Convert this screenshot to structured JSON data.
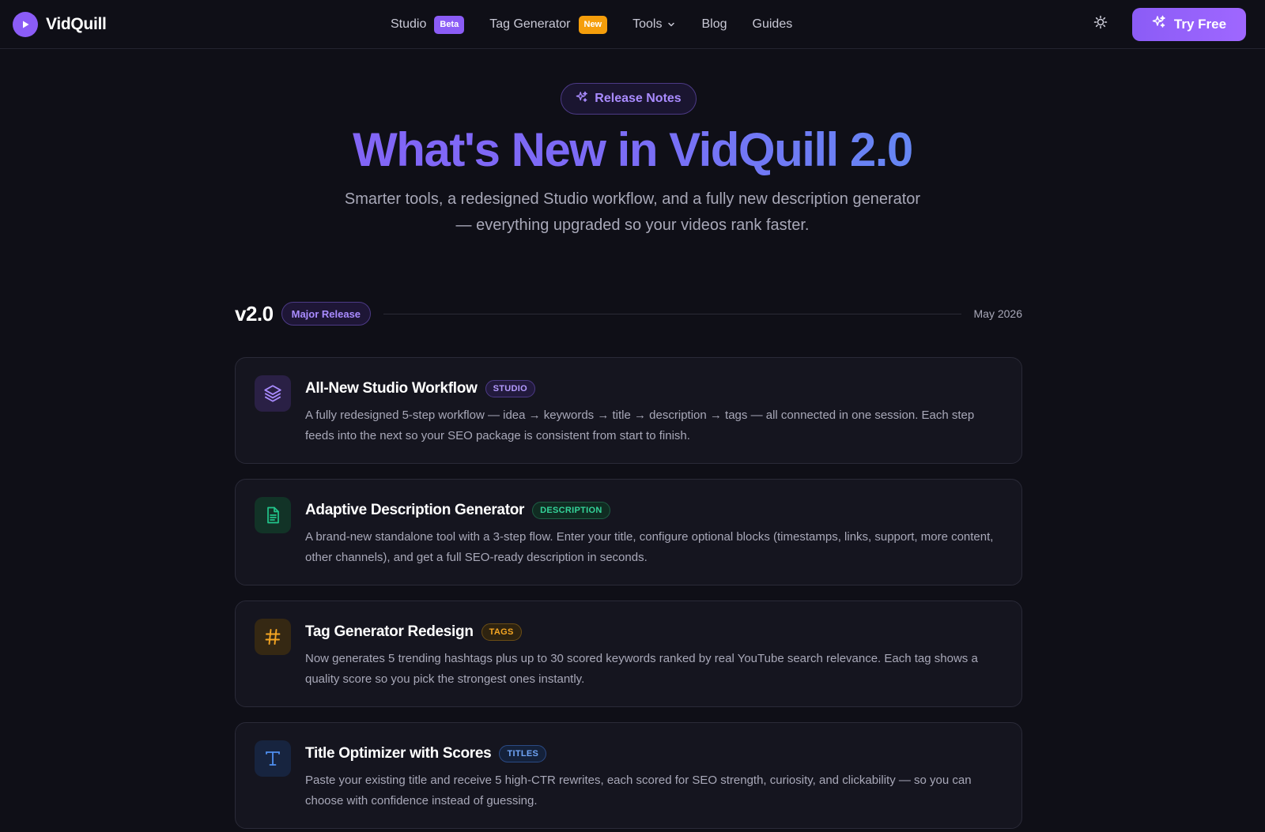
{
  "nav": {
    "brand": "VidQuill",
    "links": [
      {
        "label": "Studio",
        "badge": "Beta"
      },
      {
        "label": "Tag Generator",
        "badge": "New"
      },
      {
        "label": "Tools"
      },
      {
        "label": "Blog"
      },
      {
        "label": "Guides"
      }
    ],
    "cta": "Try Free"
  },
  "hero": {
    "pill": "Release Notes",
    "title": "What's New in VidQuill 2.0",
    "subtitle": "Smarter tools, a redesigned Studio workflow, and a fully new description generator — everything upgraded so your videos rank faster."
  },
  "release": {
    "version": "v2.0",
    "badge": "Major Release",
    "date": "May 2026"
  },
  "cards": [
    {
      "title": "All-New Studio Workflow",
      "tag": "STUDIO",
      "icon": "layers-icon",
      "accent": "#8b5cf6",
      "description": "A fully redesigned 5-step workflow — idea → keywords → title → description → tags — all connected in one session. Each step feeds into the next so your SEO package is consistent from start to finish."
    },
    {
      "title": "Adaptive Description Generator",
      "tag": "DESCRIPTION",
      "icon": "document-icon",
      "accent": "#22c58b",
      "description": "A brand-new standalone tool with a 3-step flow. Enter your title, configure optional blocks (timestamps, links, support, more content, other channels), and get a full SEO-ready description in seconds."
    },
    {
      "title": "Tag Generator Redesign",
      "tag": "TAGS",
      "icon": "hashtag-icon",
      "accent": "#f5a623",
      "description": "Now generates 5 trending hashtags plus up to 30 scored keywords ranked by real YouTube search relevance. Each tag shows a quality score so you pick the strongest ones instantly."
    },
    {
      "title": "Title Optimizer with Scores",
      "tag": "TITLES",
      "icon": "text-icon",
      "accent": "#4f8ff0",
      "description": "Paste your existing title and receive 5 high-CTR rewrites, each scored for SEO strength, curiosity, and clickability — so you can choose with confidence instead of guessing."
    }
  ]
}
